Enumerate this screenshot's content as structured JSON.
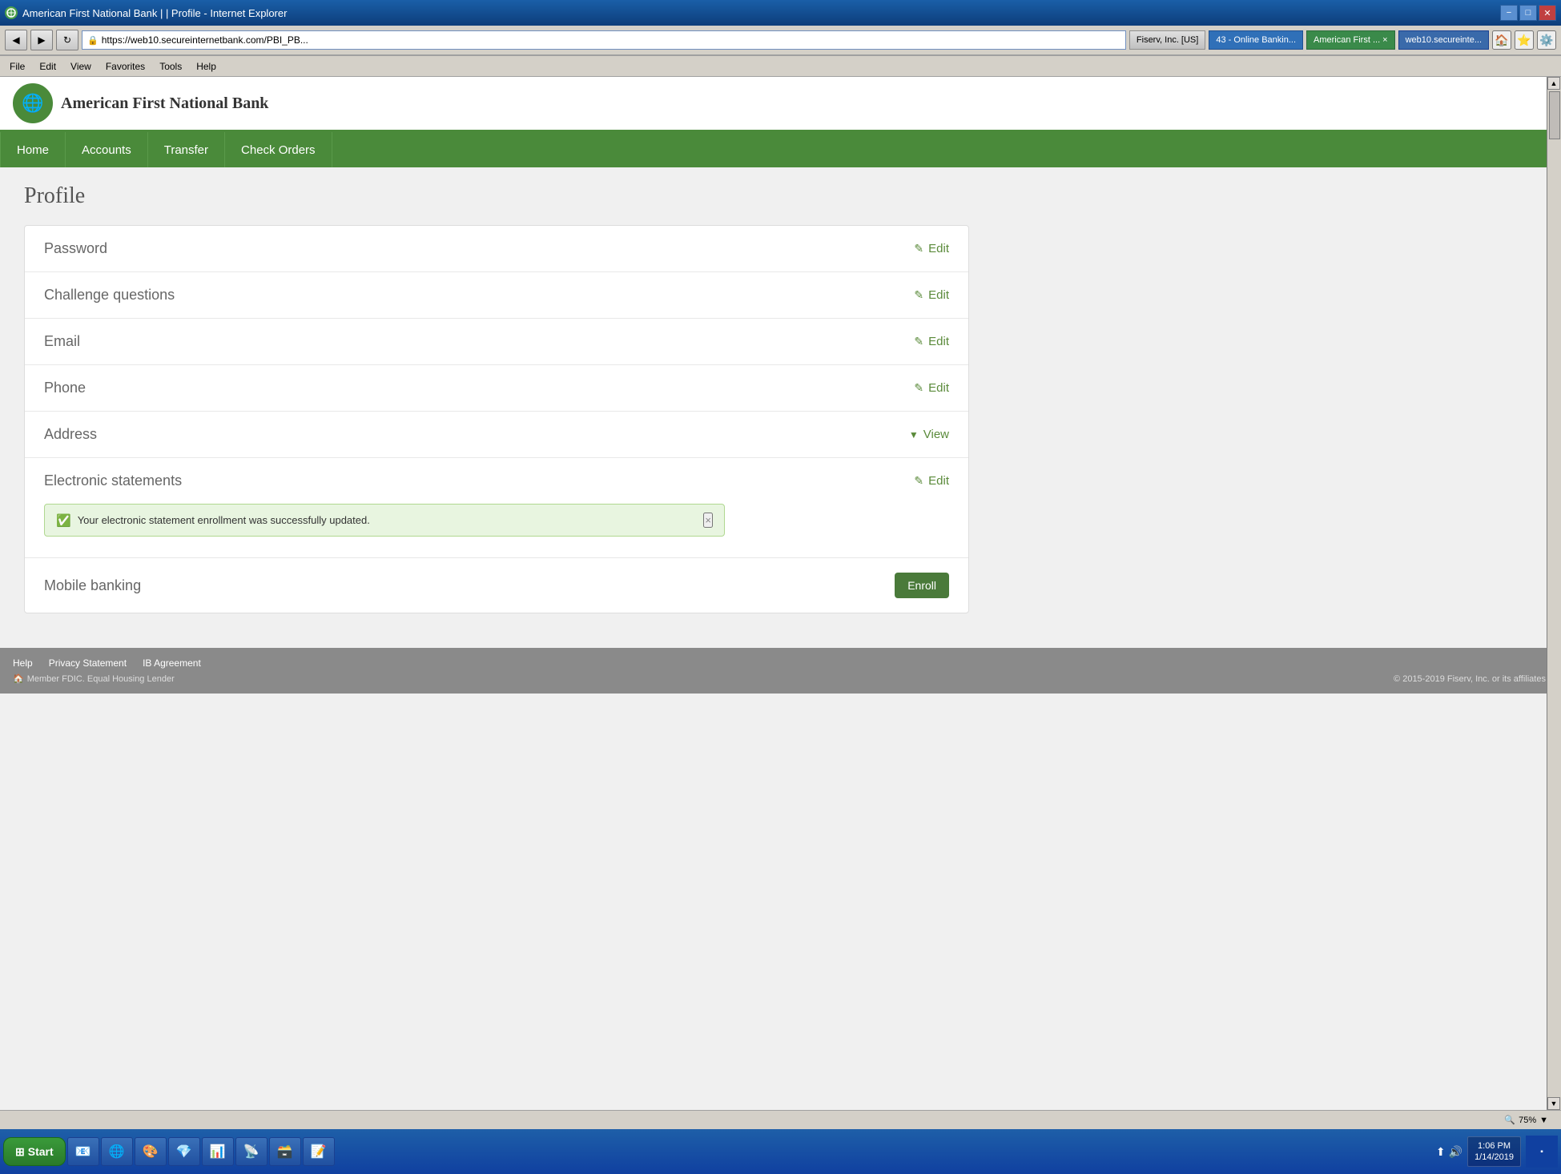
{
  "window": {
    "title": "American First National Bank |  | Profile - Internet Explorer",
    "url": "https://web10.secureinternetbank.com/PBI_PB...",
    "minimize": "−",
    "maximize": "□",
    "close": "✕"
  },
  "browser_toolbar": {
    "fiserv_tab": "Fiserv, Inc. [US]",
    "tab2": "43 - Online Bankin...",
    "tab3": "American First ... ×",
    "tab4": "web10.secureinte..."
  },
  "menu": {
    "file": "File",
    "edit": "Edit",
    "view": "View",
    "favorites": "Favorites",
    "tools": "Tools",
    "help": "Help"
  },
  "bank": {
    "name": "American First National Bank",
    "logo_alt": "Globe logo"
  },
  "nav": {
    "home": "Home",
    "accounts": "Accounts",
    "transfer": "Transfer",
    "check_orders": "Check Orders"
  },
  "page": {
    "title": "Profile"
  },
  "profile_items": [
    {
      "label": "Password",
      "action_type": "edit",
      "action_label": "Edit"
    },
    {
      "label": "Challenge questions",
      "action_type": "edit",
      "action_label": "Edit"
    },
    {
      "label": "Email",
      "action_type": "edit",
      "action_label": "Edit"
    },
    {
      "label": "Phone",
      "action_type": "edit",
      "action_label": "Edit"
    },
    {
      "label": "Address",
      "action_type": "view",
      "action_label": "View"
    },
    {
      "label": "Electronic statements",
      "action_type": "edit",
      "action_label": "Edit"
    },
    {
      "label": "Mobile banking",
      "action_type": "enroll",
      "action_label": "Enroll"
    }
  ],
  "success_message": {
    "text": "Your electronic statement enrollment was successfully updated.",
    "close": "×"
  },
  "footer": {
    "links": [
      "Help",
      "Privacy Statement",
      "IB Agreement"
    ],
    "member_text": "Member FDIC. Equal Housing Lender",
    "copyright": "© 2015-2019 Fiserv, Inc. or its affiliates."
  },
  "taskbar": {
    "start": "Start",
    "apps": [
      {
        "name": "Outlook",
        "icon": "📧"
      },
      {
        "name": "Internet Explorer",
        "icon": "🌐"
      },
      {
        "name": "App3",
        "icon": "🎨"
      },
      {
        "name": "App4",
        "icon": "💎"
      },
      {
        "name": "App5",
        "icon": "📊"
      },
      {
        "name": "App6",
        "icon": "📡"
      },
      {
        "name": "App7",
        "icon": "🗃️"
      },
      {
        "name": "App8",
        "icon": "📝"
      }
    ],
    "time": "1:06 PM",
    "date": "1/14/2019"
  },
  "status_bar": {
    "zoom": "75%"
  },
  "colors": {
    "green_dark": "#4a8a3a",
    "green_nav": "#4a8a3a",
    "green_action": "#5a8a3a",
    "success_bg": "#e8f5e0",
    "success_border": "#b0d890"
  }
}
